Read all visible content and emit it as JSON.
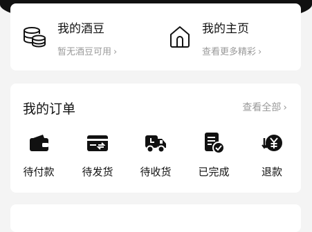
{
  "top_card": {
    "beans": {
      "title": "我的酒豆",
      "subtitle": "暂无酒豆可用",
      "chevron": "›",
      "icon": "coin-stack-icon"
    },
    "home": {
      "title": "我的主页",
      "subtitle": "查看更多精彩",
      "chevron": "›",
      "icon": "house-icon"
    }
  },
  "orders": {
    "title": "我的订单",
    "view_all": "查看全部",
    "chevron": "›",
    "statuses": [
      {
        "label": "待付款",
        "icon": "wallet-icon"
      },
      {
        "label": "待发货",
        "icon": "card-transfer-icon"
      },
      {
        "label": "待收货",
        "icon": "truck-icon"
      },
      {
        "label": "已完成",
        "icon": "document-check-icon"
      },
      {
        "label": "退款",
        "icon": "refund-yen-icon"
      }
    ]
  },
  "colors": {
    "accent": "#111111",
    "muted": "#9a9a9a",
    "background": "#f4f4f4",
    "card": "#ffffff"
  }
}
